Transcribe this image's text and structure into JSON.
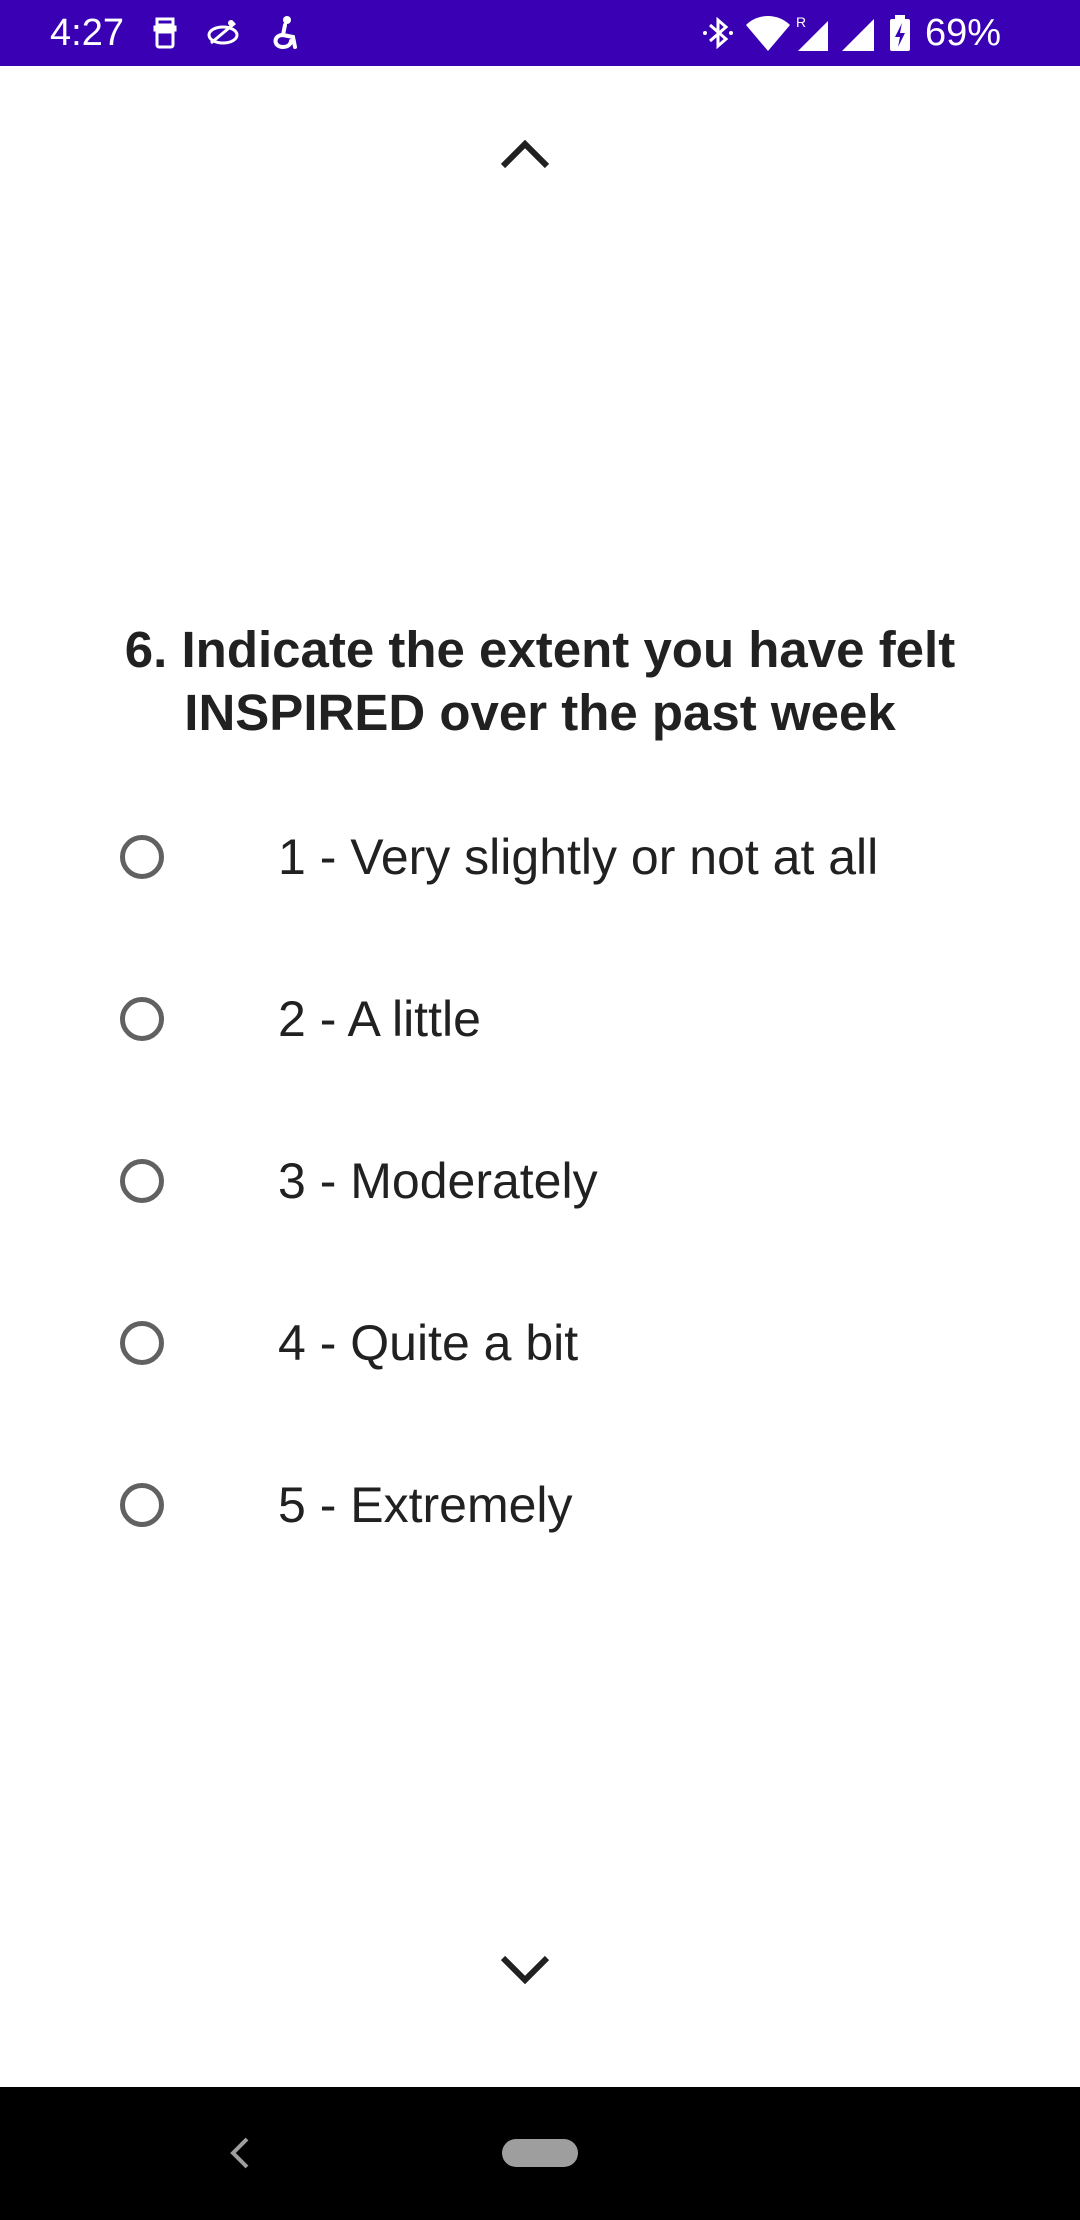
{
  "status_bar": {
    "time": "4:27",
    "battery_percent": "69%",
    "background_color": "#3a00b4",
    "left_icons": [
      "sim-icon",
      "satellite-icon",
      "accessibility-icon"
    ],
    "right_icons": [
      "bluetooth-icon",
      "wifi-icon",
      "signal-roaming-icon",
      "signal-icon",
      "battery-charging-icon"
    ]
  },
  "survey": {
    "question": "6. Indicate the extent you have felt INSPIRED over the past week",
    "options": [
      {
        "label": "1 - Very slightly or not at all",
        "selected": false
      },
      {
        "label": "2 - A little",
        "selected": false
      },
      {
        "label": "3 - Moderately",
        "selected": false
      },
      {
        "label": "4 - Quite a bit",
        "selected": false
      },
      {
        "label": "5 - Extremely",
        "selected": false
      }
    ]
  },
  "navigation": {
    "scroll_up_icon": "chevron-up-icon",
    "scroll_down_icon": "chevron-down-icon",
    "back_icon": "back-icon",
    "home_icon": "home-pill-icon"
  }
}
